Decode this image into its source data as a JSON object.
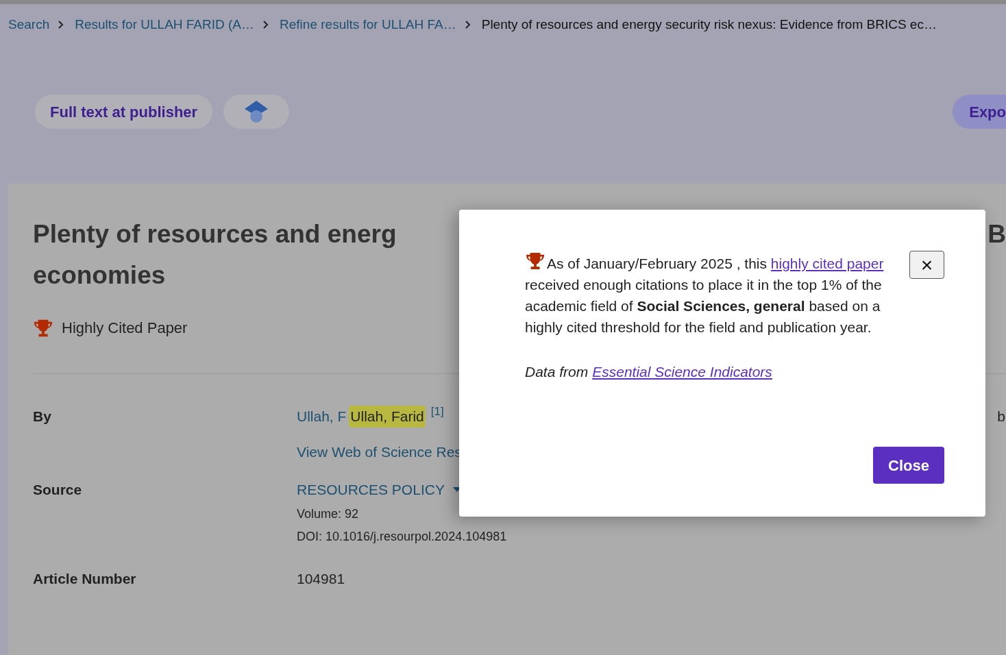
{
  "breadcrumbs": [
    {
      "label": "Search",
      "current": false
    },
    {
      "label": "Results for ULLAH FARID (A…",
      "current": false
    },
    {
      "label": "Refine results for ULLAH FA…",
      "current": false
    },
    {
      "label": "Plenty of resources and energy security risk nexus: Evidence from BRICS ec…",
      "current": true
    }
  ],
  "actions": {
    "full_text": "Full text at publisher",
    "export": "Expo"
  },
  "record": {
    "title_lines": [
      "Plenty of resources and energ",
      "economies"
    ],
    "title_edge": "B",
    "badge": "Highly Cited Paper",
    "by": {
      "label": "By",
      "author": "Ullah, F",
      "author_full": "Ullah, Farid",
      "affiliation_ref": "[1]",
      "researcher_link": "View Web of Science Res",
      "edge_text": "b"
    },
    "source": {
      "label": "Source",
      "journal": "RESOURCES POLICY",
      "volume": "Volume: 92",
      "doi": "DOI: 10.1016/j.resourpol.2024.104981"
    },
    "article_number": {
      "label": "Article Number",
      "value": "104981"
    }
  },
  "dialog": {
    "intro": "As of January/February 2025 , this ",
    "link": "highly cited paper",
    "body": "received enough citations to place it in the top 1% of the academic field of **Social Sciences, general** based on a highly cited threshold for the field and publication year.",
    "data_from": "Data from",
    "data_link": "Essential Science Indicators",
    "close_icon": "×",
    "close": "Close"
  }
}
